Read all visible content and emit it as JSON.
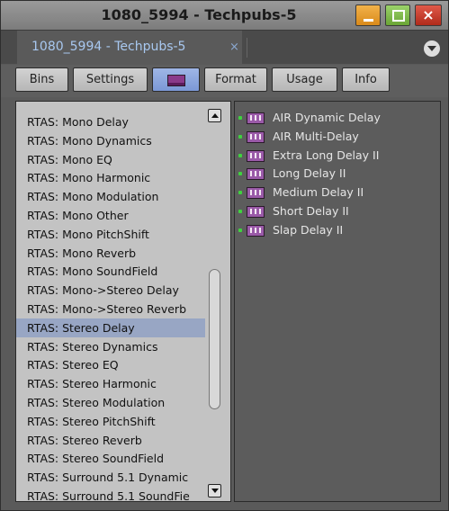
{
  "window": {
    "title": "1080_5994 - Techpubs-5",
    "close_glyph": "×",
    "colors": {
      "minimize": "#e3a038",
      "maximize": "#80bb4c",
      "close": "#c8402e"
    }
  },
  "tab": {
    "label": "1080_5994 - Techpubs-5",
    "close_glyph": "×"
  },
  "toolbar": {
    "buttons": [
      {
        "label": "Bins"
      },
      {
        "label": "Settings"
      },
      {
        "label": "",
        "icon": "effect-swatch-icon",
        "active": true
      },
      {
        "label": "Format"
      },
      {
        "label": "Usage"
      },
      {
        "label": "Info"
      }
    ]
  },
  "categories": {
    "items": [
      "RTAS: Mono Delay",
      "RTAS: Mono Dynamics",
      "RTAS: Mono EQ",
      "RTAS: Mono Harmonic",
      "RTAS: Mono Modulation",
      "RTAS: Mono Other",
      "RTAS: Mono PitchShift",
      "RTAS: Mono Reverb",
      "RTAS: Mono SoundField",
      "RTAS: Mono->Stereo Delay",
      "RTAS: Mono->Stereo Reverb",
      "RTAS: Stereo Delay",
      "RTAS: Stereo Dynamics",
      "RTAS: Stereo EQ",
      "RTAS: Stereo Harmonic",
      "RTAS: Stereo Modulation",
      "RTAS: Stereo PitchShift",
      "RTAS: Stereo Reverb",
      "RTAS: Stereo SoundField",
      "RTAS: Surround 5.1 Dynamic",
      "RTAS: Surround 5.1 SoundFie"
    ],
    "selected": "RTAS: Stereo Delay",
    "selection_color": "#98a6c4"
  },
  "effects": {
    "items": [
      "AIR Dynamic Delay",
      "AIR Multi-Delay",
      "Extra Long Delay II",
      "Long Delay II",
      "Medium Delay II",
      "Short Delay II",
      "Slap Delay II"
    ],
    "icon": "audio-plugin-icon",
    "indicator_color": "#3fd23f"
  }
}
